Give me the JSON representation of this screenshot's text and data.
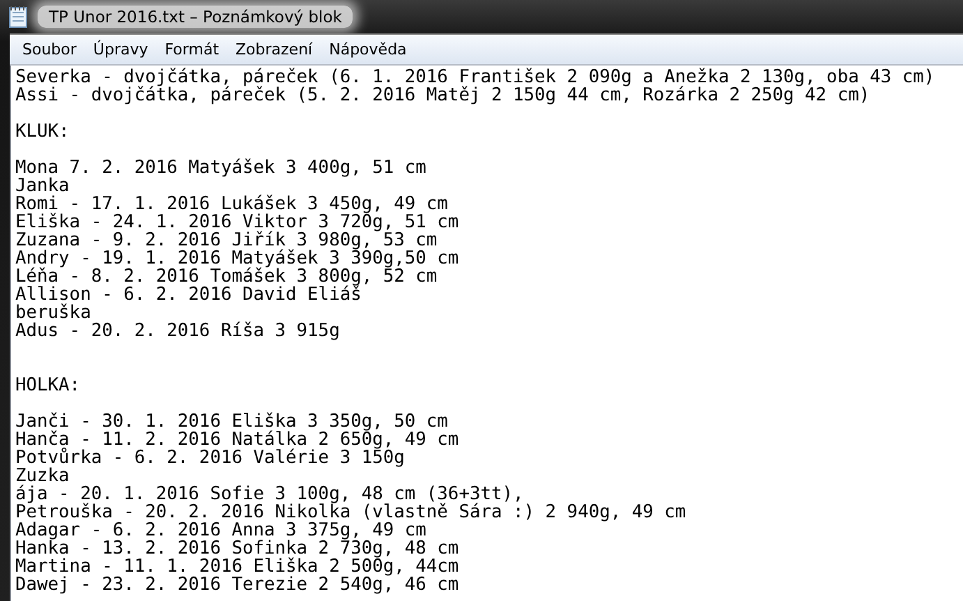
{
  "window": {
    "title": "TP Unor 2016.txt – Poznámkový blok"
  },
  "menu": [
    {
      "label": "Soubor"
    },
    {
      "label": "Úpravy"
    },
    {
      "label": "Formát"
    },
    {
      "label": "Zobrazení"
    },
    {
      "label": "Nápověda"
    }
  ],
  "lines": [
    {
      "kind": "text",
      "text": "Severka - dvojčátka, páreček (6. 1. 2016 František 2 090g a Anežka 2 130g, oba 43 cm)"
    },
    {
      "kind": "text",
      "text": "Assi - dvojčátka, páreček (5. 2. 2016 Matěj 2 150g 44 cm, Rozárka 2 250g 42 cm)"
    },
    {
      "kind": "blank"
    },
    {
      "kind": "text",
      "text": "KLUK:"
    },
    {
      "kind": "blank"
    },
    {
      "kind": "text",
      "text": "Mona 7. 2. 2016 Matyášek 3 400g, 51 cm"
    },
    {
      "kind": "text",
      "text": "Janka"
    },
    {
      "kind": "text",
      "text": "Romi - 17. 1. 2016 Lukášek 3 450g, 49 cm"
    },
    {
      "kind": "text",
      "text": "Eliška - 24. 1. 2016 Viktor 3 720g, 51 cm"
    },
    {
      "kind": "text",
      "text": "Zuzana - 9. 2. 2016 Jiřík 3 980g, 53 cm"
    },
    {
      "kind": "text",
      "text": "Andry - 19. 1. 2016 Matyášek 3 390g,50 cm"
    },
    {
      "kind": "text",
      "text": "Léňa - 8. 2. 2016 Tomášek 3 800g, 52 cm"
    },
    {
      "kind": "text",
      "text": "Allison - 6. 2. 2016 David Eliáš"
    },
    {
      "kind": "text",
      "text": "beruška"
    },
    {
      "kind": "text",
      "text": "Adus - 20. 2. 2016 Ríša 3 915g"
    },
    {
      "kind": "blank"
    },
    {
      "kind": "blank"
    },
    {
      "kind": "text",
      "text": "HOLKA:"
    },
    {
      "kind": "blank"
    },
    {
      "kind": "text",
      "text": "Janči - 30. 1. 2016 Eliška 3 350g, 50 cm"
    },
    {
      "kind": "text",
      "text": "Hanča - 11. 2. 2016 Natálka 2 650g, 49 cm"
    },
    {
      "kind": "text",
      "text": "Potvůrka - 6. 2. 2016 Valérie 3 150g"
    },
    {
      "kind": "text",
      "text": "Zuzka"
    },
    {
      "kind": "text",
      "text": "ája - 20. 1. 2016 Sofie 3 100g, 48 cm (36+3tt),"
    },
    {
      "kind": "text",
      "text": "Petrouška - 20. 2. 2016 Nikolka (vlastně Sára :) 2 940g, 49 cm"
    },
    {
      "kind": "text",
      "text": "Adagar - 6. 2. 2016 Anna 3 375g, 49 cm"
    },
    {
      "kind": "text",
      "text": "Hanka - 13. 2. 2016 Sofinka 2 730g, 48 cm"
    },
    {
      "kind": "text",
      "text": "Martina - 11. 1. 2016 Eliška 2 500g, 44cm"
    },
    {
      "kind": "text",
      "text": "Dawej - 23. 2. 2016 Terezie 2 540g, 46 cm"
    }
  ]
}
